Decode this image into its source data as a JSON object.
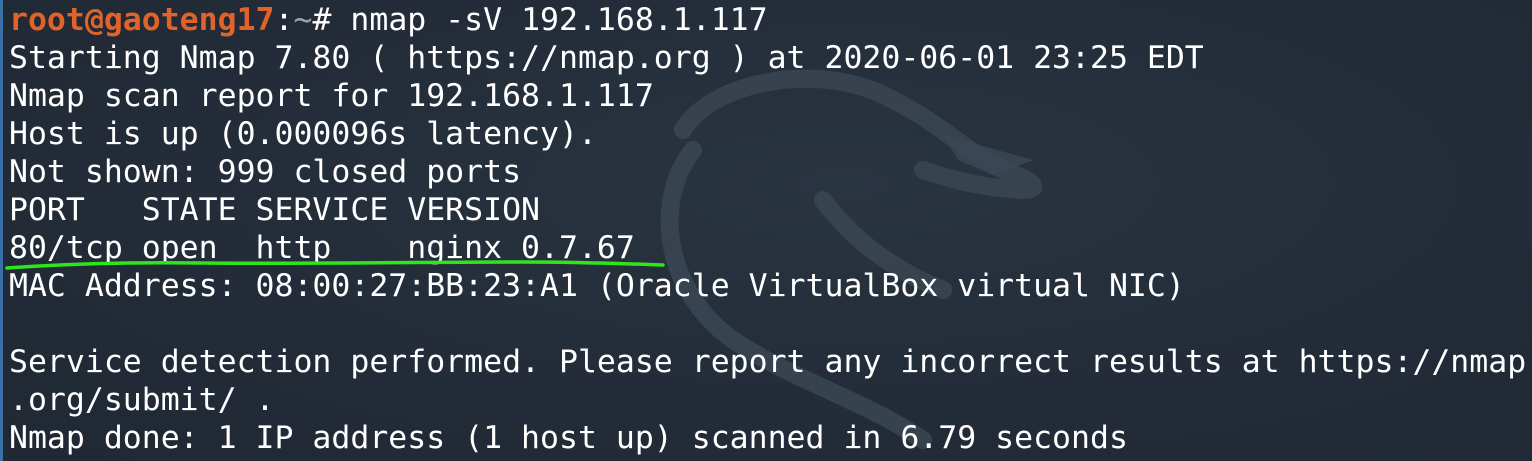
{
  "prompt": {
    "user_host": "root@gaoteng17",
    "separator": ":",
    "path": "~",
    "symbol": "# ",
    "command": "nmap -sV 192.168.1.117"
  },
  "output": {
    "starting": "Starting Nmap 7.80 ( https://nmap.org ) at 2020-06-01 23:25 EDT",
    "report": "Nmap scan report for 192.168.1.117",
    "host_up": "Host is up (0.000096s latency).",
    "not_shown": "Not shown: 999 closed ports",
    "header": "PORT   STATE SERVICE VERSION",
    "port_row": "80/tcp open  http    nginx 0.7.67",
    "mac": "MAC Address: 08:00:27:BB:23:A1 (Oracle VirtualBox virtual NIC)",
    "blank": "",
    "service_detection_1": "Service detection performed. Please report any incorrect results at https://nmap",
    "service_detection_2": ".org/submit/ .",
    "done": "Nmap done: 1 IP address (1 host up) scanned in 6.79 seconds"
  },
  "colors": {
    "background": "#232d3a",
    "prompt_user": "#e0642a",
    "text": "#ffffff",
    "annotation_underline": "#2ee61a"
  },
  "icons": {
    "watermark": "kali-dragon-icon"
  }
}
